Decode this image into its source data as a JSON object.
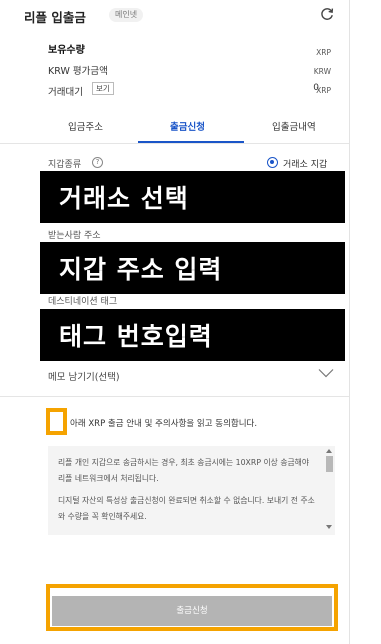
{
  "header": {
    "title": "리플 입출금",
    "network_badge": "메인넷",
    "refresh_icon": "refresh-icon"
  },
  "balances": {
    "holding_label": "보유수량",
    "holding_unit": "XRP",
    "krw_label": "KRW 평가금액",
    "krw_unit": "KRW",
    "pending_label": "거래대기",
    "view_button": "보기",
    "pending_value": "0",
    "pending_unit": "XRP"
  },
  "tabs": [
    {
      "label": "입금주소"
    },
    {
      "label": "출금신청"
    },
    {
      "label": "입출금내역"
    }
  ],
  "form": {
    "wallet_type_label": "지갑종류",
    "help_icon": "?",
    "wallet_type_option": "거래소 지갑",
    "exchange_select_text": "거래소 선택",
    "recipient_address_label": "받는사람 주소",
    "wallet_address_text": "지갑 주소 입력",
    "destination_tag_label": "데스티네이션 태그",
    "tag_input_text": "태그 번호입력",
    "memo_label": "메모 남기기(선택)"
  },
  "agreement": {
    "text": "아래 XRP 출금 안내 및 주의사항을 읽고 동의합니다."
  },
  "notice": {
    "paragraph1": "리플 개인 지갑으로 송금하시는 경우, 최초 송금시에는 10XRP 이상 송금해야 리플 네트워크에서 처리됩니다.",
    "paragraph2": "디지털 자산의 특성상 출금신청이 완료되면 취소할 수 없습니다. 보내기 전 주소와 수량을 꼭 확인해주세요."
  },
  "submit": {
    "label": "출금신청"
  },
  "colors": {
    "accent": "#1a55c8",
    "highlight": "#f5a300",
    "disabled_button": "#b4b4b4"
  }
}
